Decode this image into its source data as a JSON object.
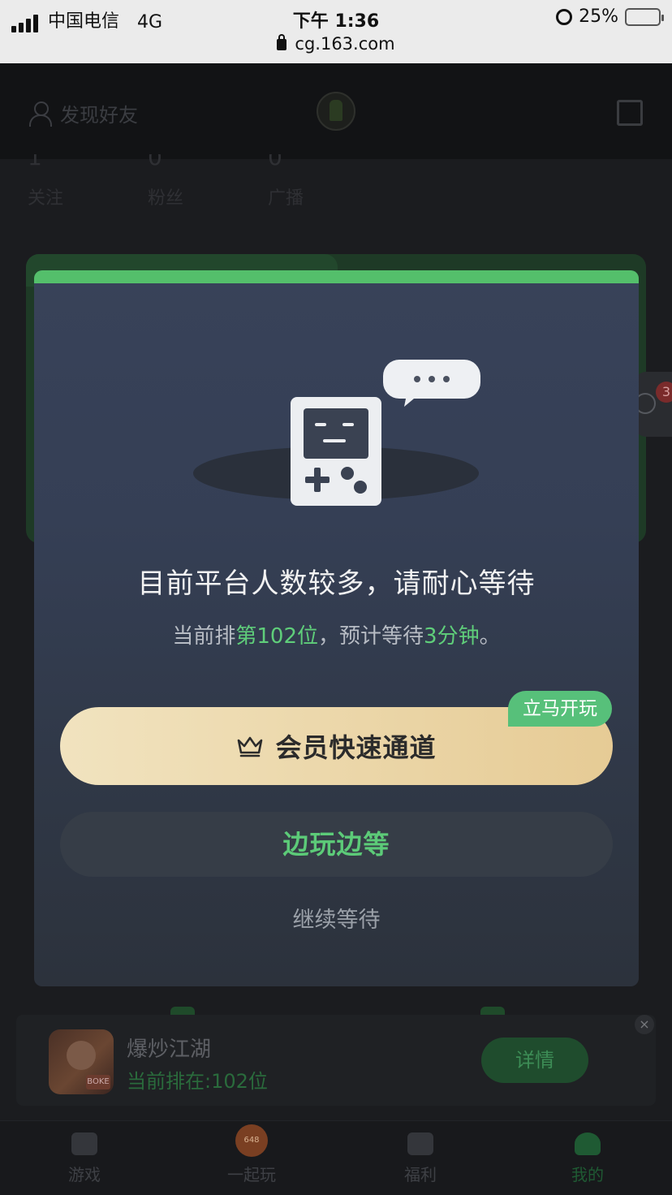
{
  "status_bar": {
    "carrier": "中国电信",
    "network": "4G",
    "time": "下午 1:36",
    "battery": "25%",
    "battery_level": 0.25,
    "url": "cg.163.com"
  },
  "header": {
    "find_friends": "发现好友",
    "icons": [
      "add-friend-icon",
      "avatar",
      "edit-icon"
    ]
  },
  "stats": [
    {
      "value": "1",
      "label": "关注"
    },
    {
      "value": "0",
      "label": "粉丝"
    },
    {
      "value": "0",
      "label": "广播"
    }
  ],
  "floating": {
    "badge": "3"
  },
  "modal": {
    "title": "目前平台人数较多，请耐心等待",
    "subtitle": {
      "prefix": "当前排",
      "position": "第102位",
      "middle": "，预计等待",
      "wait": "3分钟",
      "suffix": "。"
    },
    "vip_button": "会员快速通道",
    "vip_tag": "立马开玩",
    "play_wait_button": "边玩边等",
    "keep_waiting": "继续等待",
    "colors": {
      "accent": "#54bf6b",
      "gold": "#ebd6a8",
      "highlight": "#5fce7a"
    }
  },
  "queue_bar": {
    "game_name": "爆炒江湖",
    "position": "当前排在:102位",
    "detail_button": "详情",
    "close": "×",
    "thumb_tag": "BOKE"
  },
  "tabbar": {
    "items": [
      {
        "label": "游戏",
        "icon": "gamepad-icon"
      },
      {
        "label": "一起玩",
        "icon": "event-badge-icon"
      },
      {
        "label": "福利",
        "icon": "gift-icon"
      },
      {
        "label": "我的",
        "icon": "profile-icon",
        "active": true
      }
    ],
    "event_badge": "648"
  }
}
